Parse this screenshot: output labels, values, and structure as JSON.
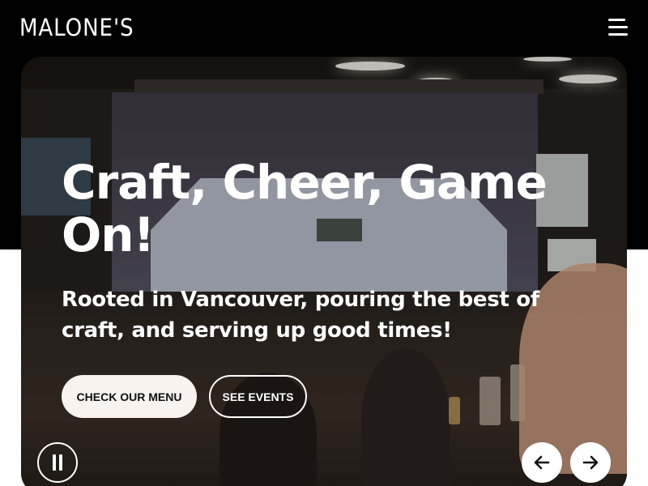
{
  "brand": {
    "logo_text": "MALONE'S"
  },
  "header": {
    "menu_icon": "hamburger-menu-icon"
  },
  "hero": {
    "headline": "Craft, Cheer, Game On!",
    "subheadline": "Rooted in Vancouver, pouring the best of craft, and serving up good times!",
    "primary_button": "CHECK OUR MENU",
    "secondary_button": "SEE EVENTS",
    "controls": {
      "pause_icon": "pause-icon",
      "prev_icon": "arrow-left-icon",
      "next_icon": "arrow-right-icon"
    }
  },
  "colors": {
    "header_bg": "#000000",
    "page_bg": "#ffffff",
    "primary_button_bg": "#f8f3ee",
    "text_light": "#ffffff"
  }
}
